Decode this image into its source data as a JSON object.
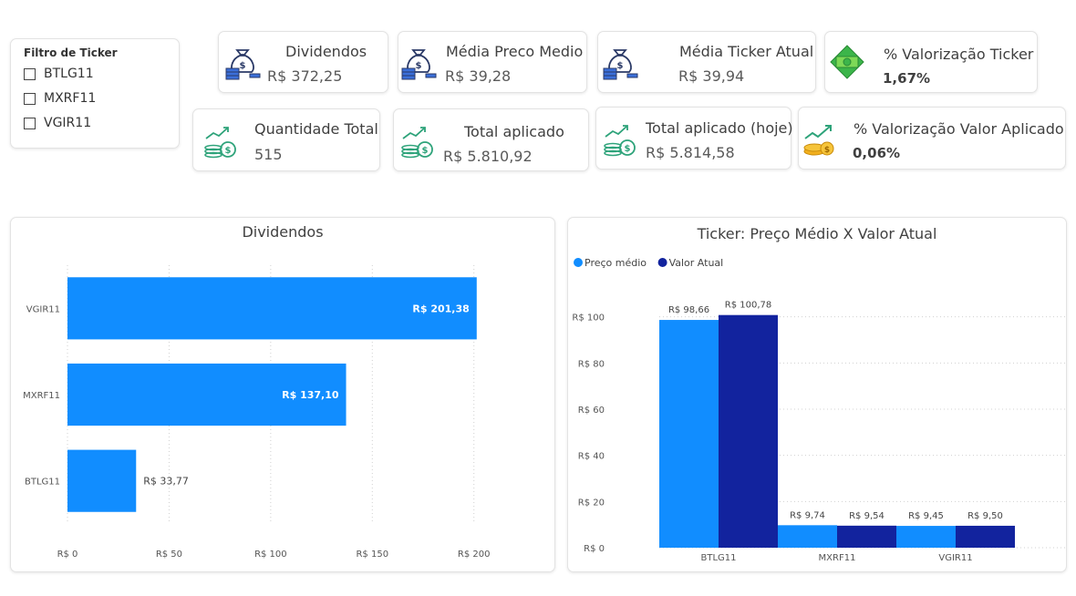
{
  "filter": {
    "title": "Filtro de Ticker",
    "items": [
      "BTLG11",
      "MXRF11",
      "VGIR11"
    ]
  },
  "kpis": {
    "dividendos": {
      "title": "Dividendos",
      "value": "R$ 372,25"
    },
    "media_preco_medio": {
      "title": "Média Preco Medio",
      "value": "R$ 39,28"
    },
    "media_ticker_atual": {
      "title": "Média Ticker Atual",
      "value": "R$ 39,94"
    },
    "valorizacao_ticker": {
      "title": "% Valorização Ticker",
      "value": "1,67%"
    },
    "quantidade_total": {
      "title": "Quantidade Total",
      "value": "515"
    },
    "total_aplicado": {
      "title": "Total aplicado",
      "value": "R$ 5.810,92"
    },
    "total_aplicado_hoje": {
      "title": "Total aplicado (hoje)",
      "value": "R$ 5.814,58"
    },
    "valorizacao_valor_aplicado": {
      "title": "% Valorização Valor Aplicado",
      "value": "0,06%"
    }
  },
  "colors": {
    "primary": "#118dff",
    "secondary": "#12239e",
    "icon_navy": "#2b3a67",
    "icon_green": "#2ea37a"
  },
  "chart_data": [
    {
      "type": "bar",
      "orientation": "horizontal",
      "title": "Dividendos",
      "categories": [
        "VGIR11",
        "MXRF11",
        "BTLG11"
      ],
      "values": [
        201.38,
        137.1,
        33.77
      ],
      "data_labels": [
        "R$ 201,38",
        "R$ 137,10",
        "R$ 33,77"
      ],
      "xlim": [
        0,
        210
      ],
      "x_ticks": [
        0,
        50,
        100,
        150,
        200
      ],
      "x_tick_labels": [
        "R$ 0",
        "R$ 50",
        "R$ 100",
        "R$ 150",
        "R$ 200"
      ],
      "grid": true
    },
    {
      "type": "bar",
      "title": "Ticker: Preço Médio X Valor Atual",
      "categories": [
        "BTLG11",
        "MXRF11",
        "VGIR11"
      ],
      "series": [
        {
          "name": "Preço médio",
          "values": [
            98.66,
            9.74,
            9.45
          ],
          "labels": [
            "R$ 98,66",
            "R$ 9,74",
            "R$ 9,45"
          ],
          "color": "#118dff"
        },
        {
          "name": "Valor Atual",
          "values": [
            100.78,
            9.54,
            9.5
          ],
          "labels": [
            "R$ 100,78",
            "R$ 9,54",
            "R$ 9,50"
          ],
          "color": "#12239e"
        }
      ],
      "ylim": [
        0,
        105
      ],
      "y_ticks": [
        0,
        20,
        40,
        60,
        80,
        100
      ],
      "y_tick_labels": [
        "R$ 0",
        "R$ 20",
        "R$ 40",
        "R$ 60",
        "R$ 80",
        "R$ 100"
      ],
      "legend": "top-left",
      "grid": true
    }
  ]
}
